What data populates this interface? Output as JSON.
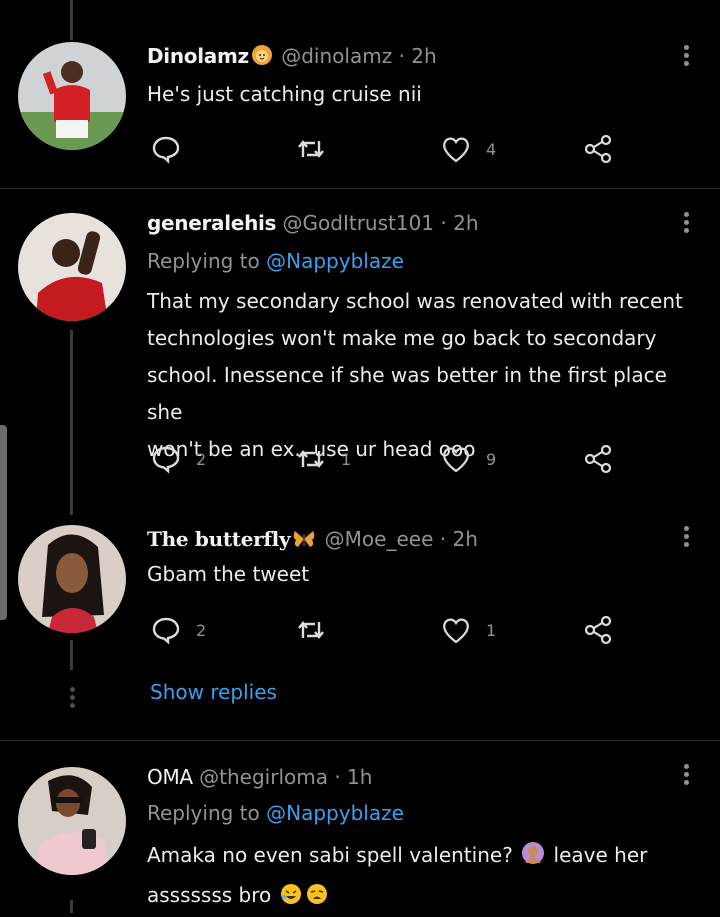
{
  "tweets": [
    {
      "name": "Dinolamz",
      "name_emoji": "lion-face-emoji",
      "handle": "@dinolamz",
      "time": "· 2h",
      "replying_to": "",
      "text": "He's just catching cruise nii",
      "replies": "",
      "retweets": "",
      "likes": "4"
    },
    {
      "name": "generalehis",
      "handle": "@GodItrust101",
      "time": "· 2h",
      "replying_label": "Replying to",
      "replying_to": "@Nappyblaze",
      "text_lines": [
        "That my secondary school was renovated with recent",
        "technologies won't make me go back to secondary",
        "school. Inessence if she was better in the first place she",
        "won't be an ex.. use ur head ooo"
      ],
      "replies": "2",
      "retweets": "1",
      "likes": "9"
    },
    {
      "name": "The butterfly",
      "name_emoji": "butterfly-emoji",
      "handle": "@Moe_eee",
      "time": "· 2h",
      "text": "Gbam the tweet",
      "replies": "2",
      "retweets": "",
      "likes": "1"
    },
    {
      "name": "OMA",
      "handle": "@thegirloma",
      "time": "· 1h",
      "replying_label": "Replying to",
      "replying_to": "@Nappyblaze",
      "text_line1_a": "Amaka no even sabi spell valentine?",
      "text_line1_b": "leave her",
      "text_line2": "asssssss bro",
      "emojis": [
        "woman-gesturing-no-emoji",
        "rolling-laughing-emoji",
        "weary-face-emoji"
      ]
    }
  ],
  "show_replies": "Show replies",
  "colors": {
    "background": "#000000",
    "text": "#ececec",
    "secondary": "#8f9398",
    "link": "#3d9ef0",
    "divider": "#2a2d30"
  }
}
